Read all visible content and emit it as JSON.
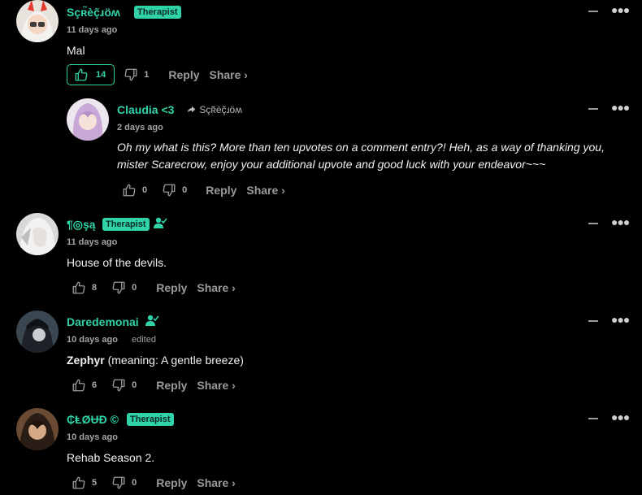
{
  "actions": {
    "reply": "Reply",
    "share": "Share ›"
  },
  "colors": {
    "accent": "#2fd3a7",
    "background": "#000000",
    "muted": "#9a9a9a"
  },
  "comments": [
    {
      "user": "Sçʀ̃èç̃ɹöʍ",
      "badge": "Therapist",
      "time": "11 days ago",
      "text": "Mal",
      "upvotes": "14",
      "downvotes": "1",
      "upvoted": true
    },
    {
      "user": "Claudia <3",
      "reply_to": "Sçʀ̃èç̃ɹöʍ",
      "time": "2 days ago",
      "text_line1": "Oh my what is this? More than ten upvotes on a comment entry?! Heh, as a way of thanking you,",
      "text_line2": "mister Scarecrow, enjoy your additional upvote and good luck with your endeavor~~~",
      "upvotes": "0",
      "downvotes": "0"
    },
    {
      "user": "¶◎şą",
      "badge": "Therapist",
      "time": "11 days ago",
      "text": "House of the devils.",
      "upvotes": "8",
      "downvotes": "0"
    },
    {
      "user": "Daredemonai",
      "time": "10 days ago",
      "edited": "edited",
      "text_bold": "Zephyr",
      "text_rest": " (meaning: A gentle breeze)",
      "upvotes": "6",
      "downvotes": "0"
    },
    {
      "user": "₵ⱠØɄĐ ©",
      "badge": "Therapist",
      "time": "10 days ago",
      "text": "Rehab Season 2.",
      "upvotes": "5",
      "downvotes": "0"
    }
  ]
}
